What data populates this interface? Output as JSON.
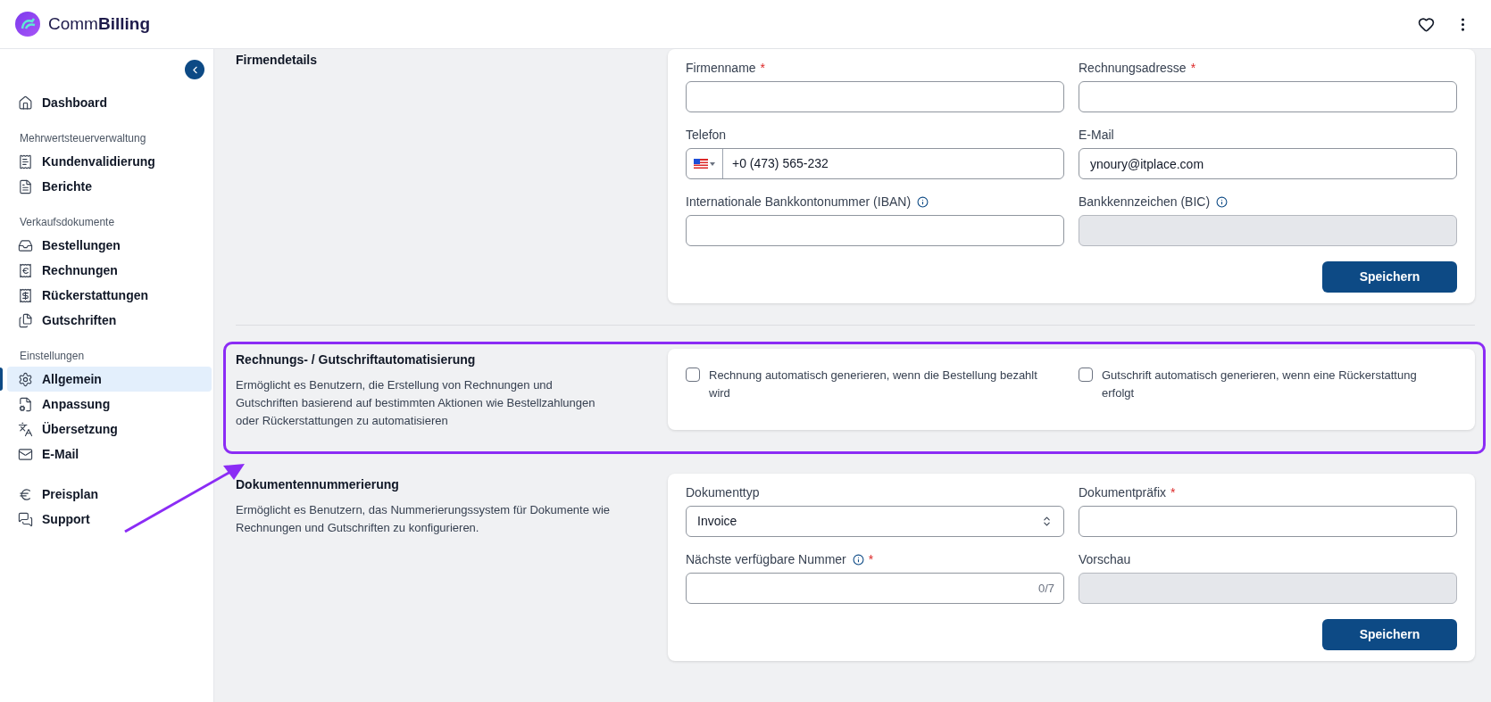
{
  "header": {
    "logo": "Comm**Billing**"
  },
  "sidebar": {
    "groups": [
      {
        "items": [
          {
            "label": "Dashboard",
            "selected": false
          }
        ]
      },
      {
        "heading": "Mehrwertsteuerverwaltung",
        "items": [
          {
            "label": "Kundenvalidierung",
            "selected": false
          },
          {
            "label": "Berichte",
            "selected": false
          }
        ]
      },
      {
        "heading": "Verkaufsdokumente",
        "items": [
          {
            "label": "Bestellungen",
            "selected": false
          },
          {
            "label": "Rechnungen",
            "selected": false
          },
          {
            "label": "Rückerstattungen",
            "selected": false
          },
          {
            "label": "Gutschriften",
            "selected": false
          }
        ]
      },
      {
        "heading": "Einstellungen",
        "items": [
          {
            "label": "Allgemein",
            "selected": true
          },
          {
            "label": "Anpassung",
            "selected": false
          },
          {
            "label": "Übersetzung",
            "selected": false
          },
          {
            "label": "E-Mail",
            "selected": false
          }
        ]
      },
      {
        "items": [
          {
            "label": "Preisplan",
            "selected": false
          },
          {
            "label": "Support",
            "selected": false
          }
        ]
      }
    ]
  },
  "sections": [
    {
      "title": "Firmendetails",
      "highlighted": false,
      "card": {
        "fields": [
          {
            "kind": "text",
            "label": "Firmenname",
            "required_mark": "*",
            "disabled": false
          },
          {
            "kind": "text",
            "label": "Rechnungsadresse",
            "required_mark": "*",
            "disabled": false
          },
          {
            "kind": "phone",
            "label": "Telefon",
            "value": "+0 (473) 565-232",
            "disabled": false
          },
          {
            "kind": "text",
            "label": "E-Mail",
            "value": "ynoury@itplace.com",
            "disabled": false
          },
          {
            "kind": "text",
            "label": "Internationale Bankkontonummer (IBAN)",
            "info": true,
            "disabled": false
          },
          {
            "kind": "text",
            "label": "Bankkennzeichen (BIC)",
            "info": true,
            "disabled": true
          }
        ],
        "button": "Speichern"
      }
    },
    {
      "title": "Rechnungs- / Gutschriftautomatisierung",
      "description": "Ermöglicht es Benutzern, die Erstellung von Rechnungen und Gutschriften basierend auf bestimmten Aktionen wie Bestellzahlungen oder Rückerstattungen zu automatisieren",
      "highlighted": true,
      "card": {
        "checkboxes": [
          {
            "label": "Rechnung automatisch generieren, wenn die Bestellung bezahlt wird",
            "checked": false
          },
          {
            "label": "Gutschrift automatisch generieren, wenn eine Rückerstattung erfolgt",
            "checked": false
          }
        ]
      }
    },
    {
      "title": "Dokumentennummerierung",
      "description": "Ermöglicht es Benutzern, das Nummerierungssystem für Dokumente wie Rechnungen und Gutschriften zu konfigurieren.",
      "highlighted": false,
      "card": {
        "fields": [
          {
            "kind": "select",
            "label": "Dokumenttyp",
            "value": "Invoice",
            "disabled": false
          },
          {
            "kind": "text",
            "label": "Dokumentpräfix",
            "required_mark": "*",
            "disabled": false
          },
          {
            "kind": "counter",
            "label": "Nächste verfügbare Nummer",
            "info": true,
            "required_mark": "*",
            "counter": "0/7",
            "disabled": false
          },
          {
            "kind": "text",
            "label": "Vorschau",
            "disabled": true
          }
        ],
        "button": "Speichern"
      }
    }
  ]
}
